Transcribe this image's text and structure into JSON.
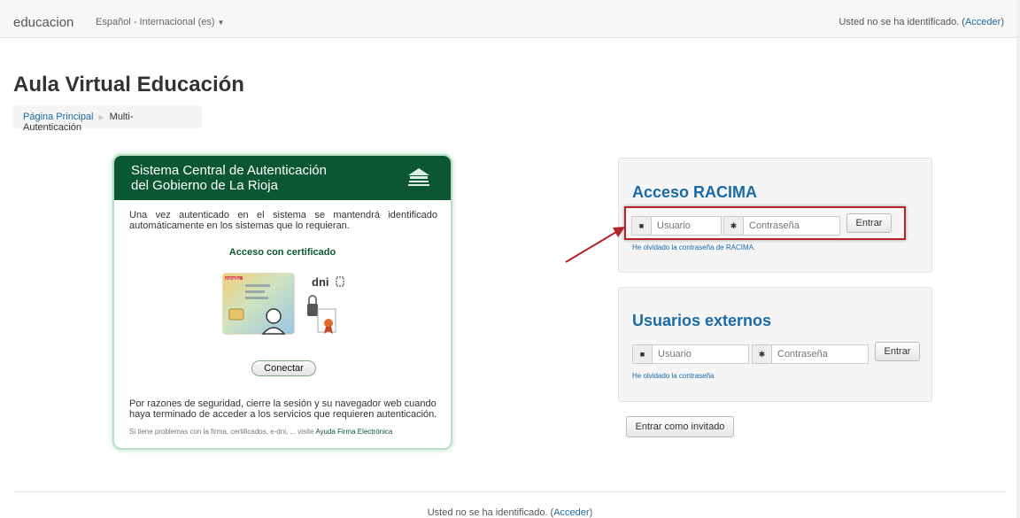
{
  "navbar": {
    "brand": "educacion",
    "language": "Español - Internacional (es)",
    "login_prefix": "Usted no se ha identificado. (",
    "login_link": "Acceder",
    "login_suffix": ")"
  },
  "page": {
    "title": "Aula Virtual Educación",
    "breadcrumb": {
      "home": "Página Principal",
      "current": "Multi-Autenticación"
    }
  },
  "cas": {
    "title_line1": "Sistema Central de Autenticación",
    "title_line2": "del Gobierno de La Rioja",
    "intro": "Una vez autenticado en el sistema se mantendrá identificado automáticamente en los sistemas que lo requieran.",
    "cert_title": "Acceso con certificado",
    "dni_label": "dni",
    "card_label": "ESPAÑA",
    "connect_button": "Conectar",
    "security_note": "Por razones de seguridad, cierre la sesión y su navegador web cuando haya terminado de acceder a los servicios que requieren autenticación.",
    "help_text": "Si tiene problemas con la firma, certificados, e-dni, ... visite ",
    "help_link": "Ayuda Firma Electrónica"
  },
  "racima": {
    "heading": "Acceso RACIMA",
    "username_placeholder": "Usuario",
    "password_placeholder": "Contraseña",
    "submit": "Entrar",
    "forgot": "He olvidado la contraseña de RACIMA."
  },
  "external": {
    "heading": "Usuarios externos",
    "username_placeholder": "Usuario",
    "password_placeholder": "Contraseña",
    "submit": "Entrar",
    "forgot": "He olvidado la contraseña"
  },
  "guest_button": "Entrar como invitado",
  "footer": {
    "prefix": "Usted no se ha identificado. (",
    "link": "Acceder",
    "suffix": ")"
  },
  "icons": {
    "user": "user-icon",
    "password": "asterisk-icon",
    "caret": "caret-down-icon",
    "logo": "rioja-logo-icon",
    "arrow": "red-arrow-annotation"
  },
  "colors": {
    "link": "#1a6aa6",
    "cas_green": "#0b5734",
    "highlight_red": "#b4232a"
  }
}
